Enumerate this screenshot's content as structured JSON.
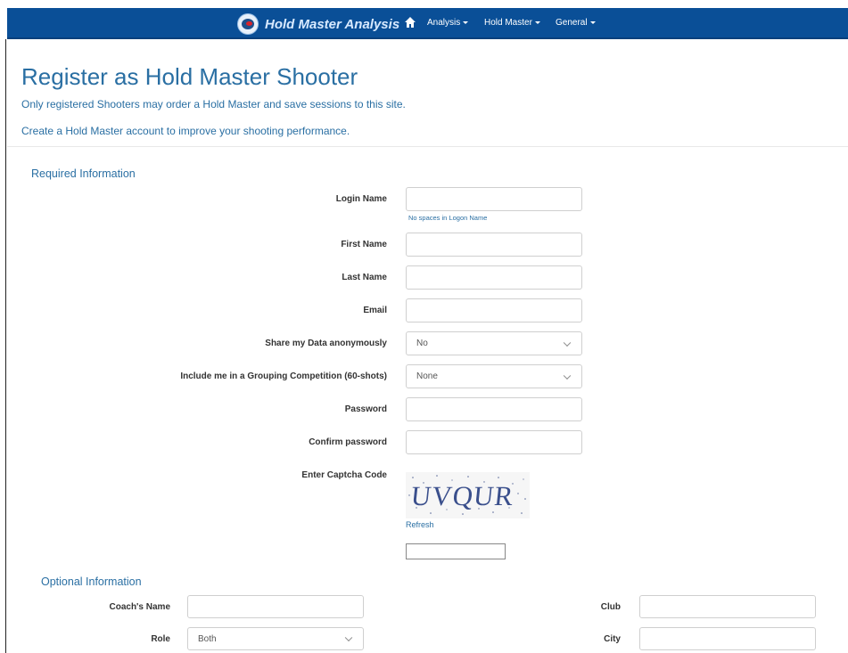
{
  "nav": {
    "brand": "Hold Master Analysis",
    "menu": [
      {
        "label": "Analysis"
      },
      {
        "label": "Hold Master"
      },
      {
        "label": "General"
      }
    ]
  },
  "page": {
    "title": "Register as Hold Master Shooter",
    "intro1": "Only registered Shooters may order a Hold Master and save sessions to this site.",
    "intro2": "Create a Hold Master account to improve your shooting performance."
  },
  "required": {
    "heading": "Required Information",
    "login_label": "Login Name",
    "login_value": "",
    "login_hint": "No spaces in Logon Name",
    "first_label": "First Name",
    "first_value": "",
    "last_label": "Last Name",
    "last_value": "",
    "email_label": "Email",
    "email_value": "",
    "share_label": "Share my Data anonymously",
    "share_value": "No",
    "competition_label": "Include me in a Grouping Competition (60-shots)",
    "competition_value": "None",
    "password_label": "Password",
    "password_value": "",
    "confirm_label": "Confirm password",
    "confirm_value": "",
    "captcha_label": "Enter Captcha Code",
    "captcha_text": "UVQUR",
    "refresh_link": "Refresh",
    "captcha_value": ""
  },
  "optional": {
    "heading": "Optional Information",
    "coach_label": "Coach's Name",
    "coach_value": "",
    "role_label": "Role",
    "role_value": "Both",
    "club_label": "Club",
    "club_value": "",
    "city_label": "City",
    "city_value": ""
  },
  "colors": {
    "navbar": "#0a4f97",
    "accent": "#2a6fa3"
  },
  "icons": {
    "home": "home-icon",
    "logo": "target-logo-icon"
  }
}
